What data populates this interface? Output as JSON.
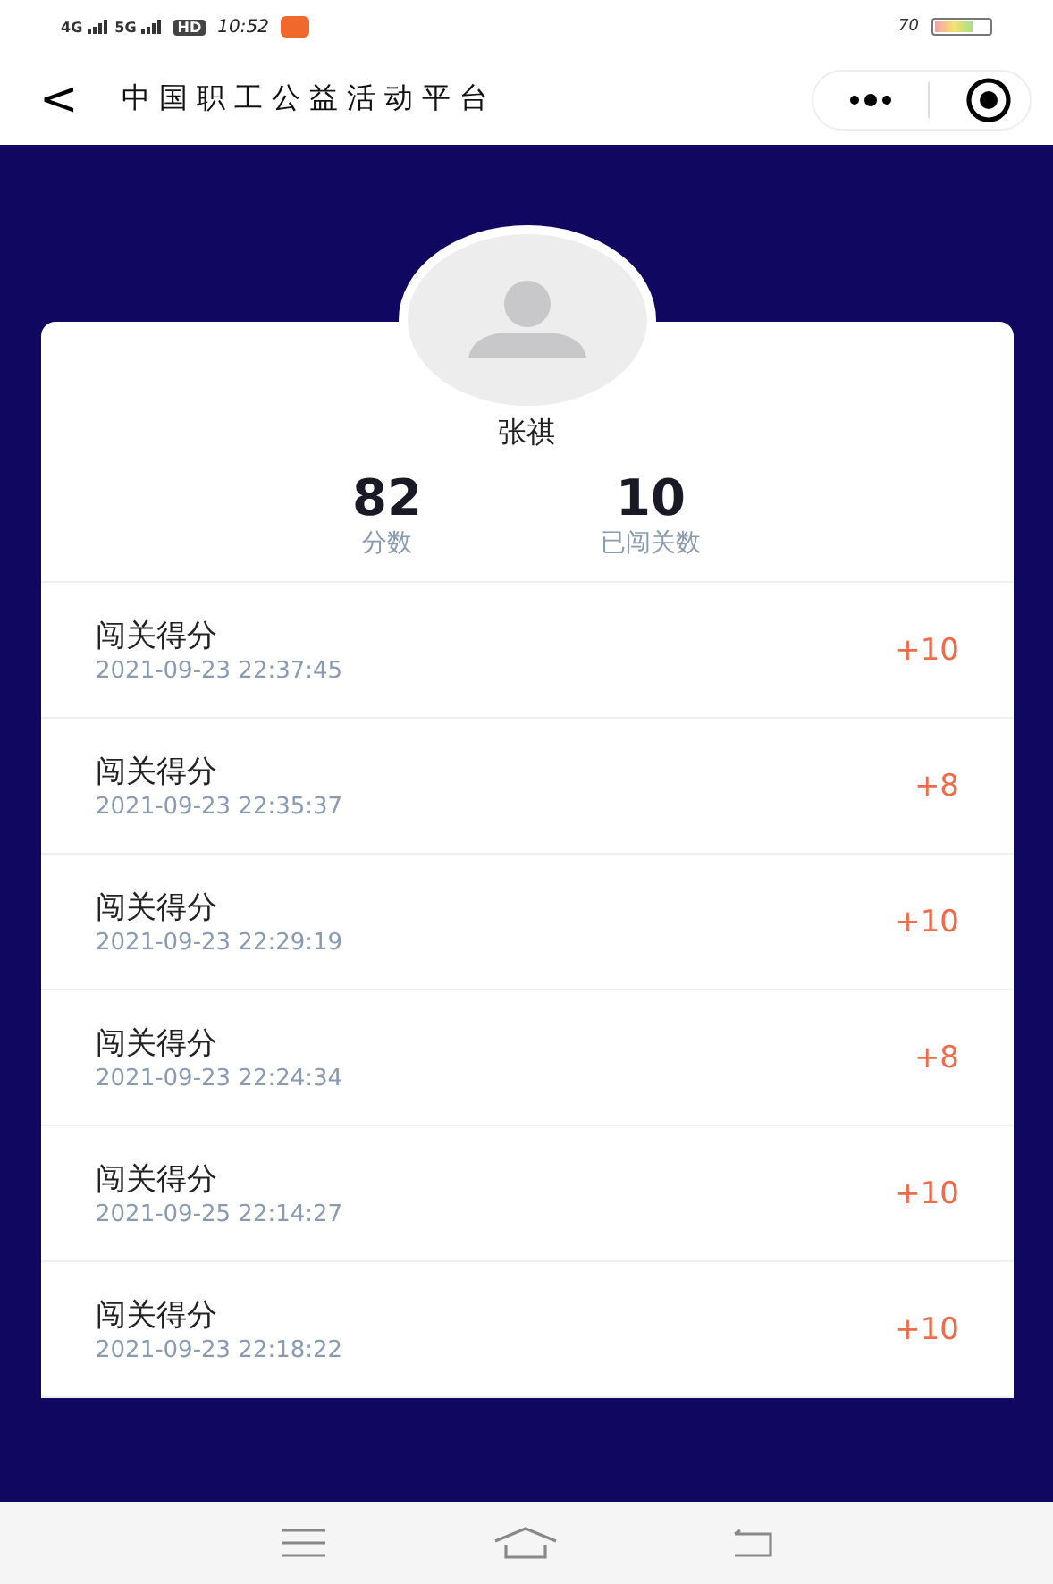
{
  "status_bar": {
    "networks": [
      "4G",
      "5G"
    ],
    "hd": "HD",
    "time": "10:52",
    "battery_percent": "70"
  },
  "nav": {
    "back": "<",
    "title": "中国职工公益活动平台"
  },
  "profile": {
    "name": "张祺",
    "stats": [
      {
        "value": "82",
        "label": "分数"
      },
      {
        "value": "10",
        "label": "已闯关数"
      }
    ]
  },
  "records": [
    {
      "title": "闯关得分",
      "time": "2021-09-23 22:37:45",
      "points": "+10"
    },
    {
      "title": "闯关得分",
      "time": "2021-09-23 22:35:37",
      "points": "+8"
    },
    {
      "title": "闯关得分",
      "time": "2021-09-23 22:29:19",
      "points": "+10"
    },
    {
      "title": "闯关得分",
      "time": "2021-09-23 22:24:34",
      "points": "+8"
    },
    {
      "title": "闯关得分",
      "time": "2021-09-25 22:14:27",
      "points": "+10"
    },
    {
      "title": "闯关得分",
      "time": "2021-09-23 22:18:22",
      "points": "+10"
    }
  ]
}
